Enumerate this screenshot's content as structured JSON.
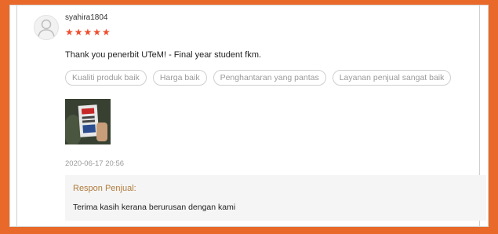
{
  "review": {
    "username": "syahira1804",
    "rating": 5,
    "stars": "★★★★★",
    "comment": "Thank you penerbit UTeM! - Final year student fkm.",
    "tags": [
      "Kualiti produk baik",
      "Harga baik",
      "Penghantaran yang pantas",
      "Layanan penjual sangat baik"
    ],
    "timestamp": "2020-06-17 20:56"
  },
  "seller_reply": {
    "title": "Respon Penjual:",
    "text": "Terima kasih kerana berurusan dengan kami"
  },
  "colors": {
    "frame": "#e8692a",
    "star": "#ee4d2d",
    "reply_title": "#b07b3b",
    "reply_bg": "#f5f5f5"
  },
  "icons": {
    "avatar": "user-avatar-icon"
  }
}
